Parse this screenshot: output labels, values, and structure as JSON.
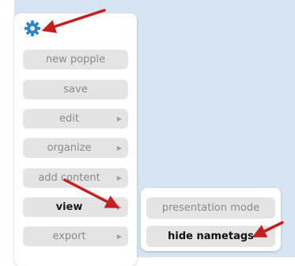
{
  "colors": {
    "gear": "#2d84c6",
    "annotation_arrow": "#c41e1e",
    "background": "#d7e4f1",
    "button": "#e4e4e4"
  },
  "icons": {
    "settings": "gear-icon",
    "submenu_indicator": "chevron-right-icon",
    "annotations": "red-arrow"
  },
  "menu": {
    "items": [
      {
        "label": "new popple",
        "has_submenu": false
      },
      {
        "label": "save",
        "has_submenu": false
      },
      {
        "label": "edit",
        "has_submenu": true
      },
      {
        "label": "organize",
        "has_submenu": true
      },
      {
        "label": "add content",
        "has_submenu": true
      },
      {
        "label": "view",
        "has_submenu": true,
        "active": true
      },
      {
        "label": "export",
        "has_submenu": true
      }
    ]
  },
  "submenu": {
    "items": [
      {
        "label": "presentation mode"
      },
      {
        "label": "hide nametags",
        "highlighted": true
      }
    ]
  }
}
